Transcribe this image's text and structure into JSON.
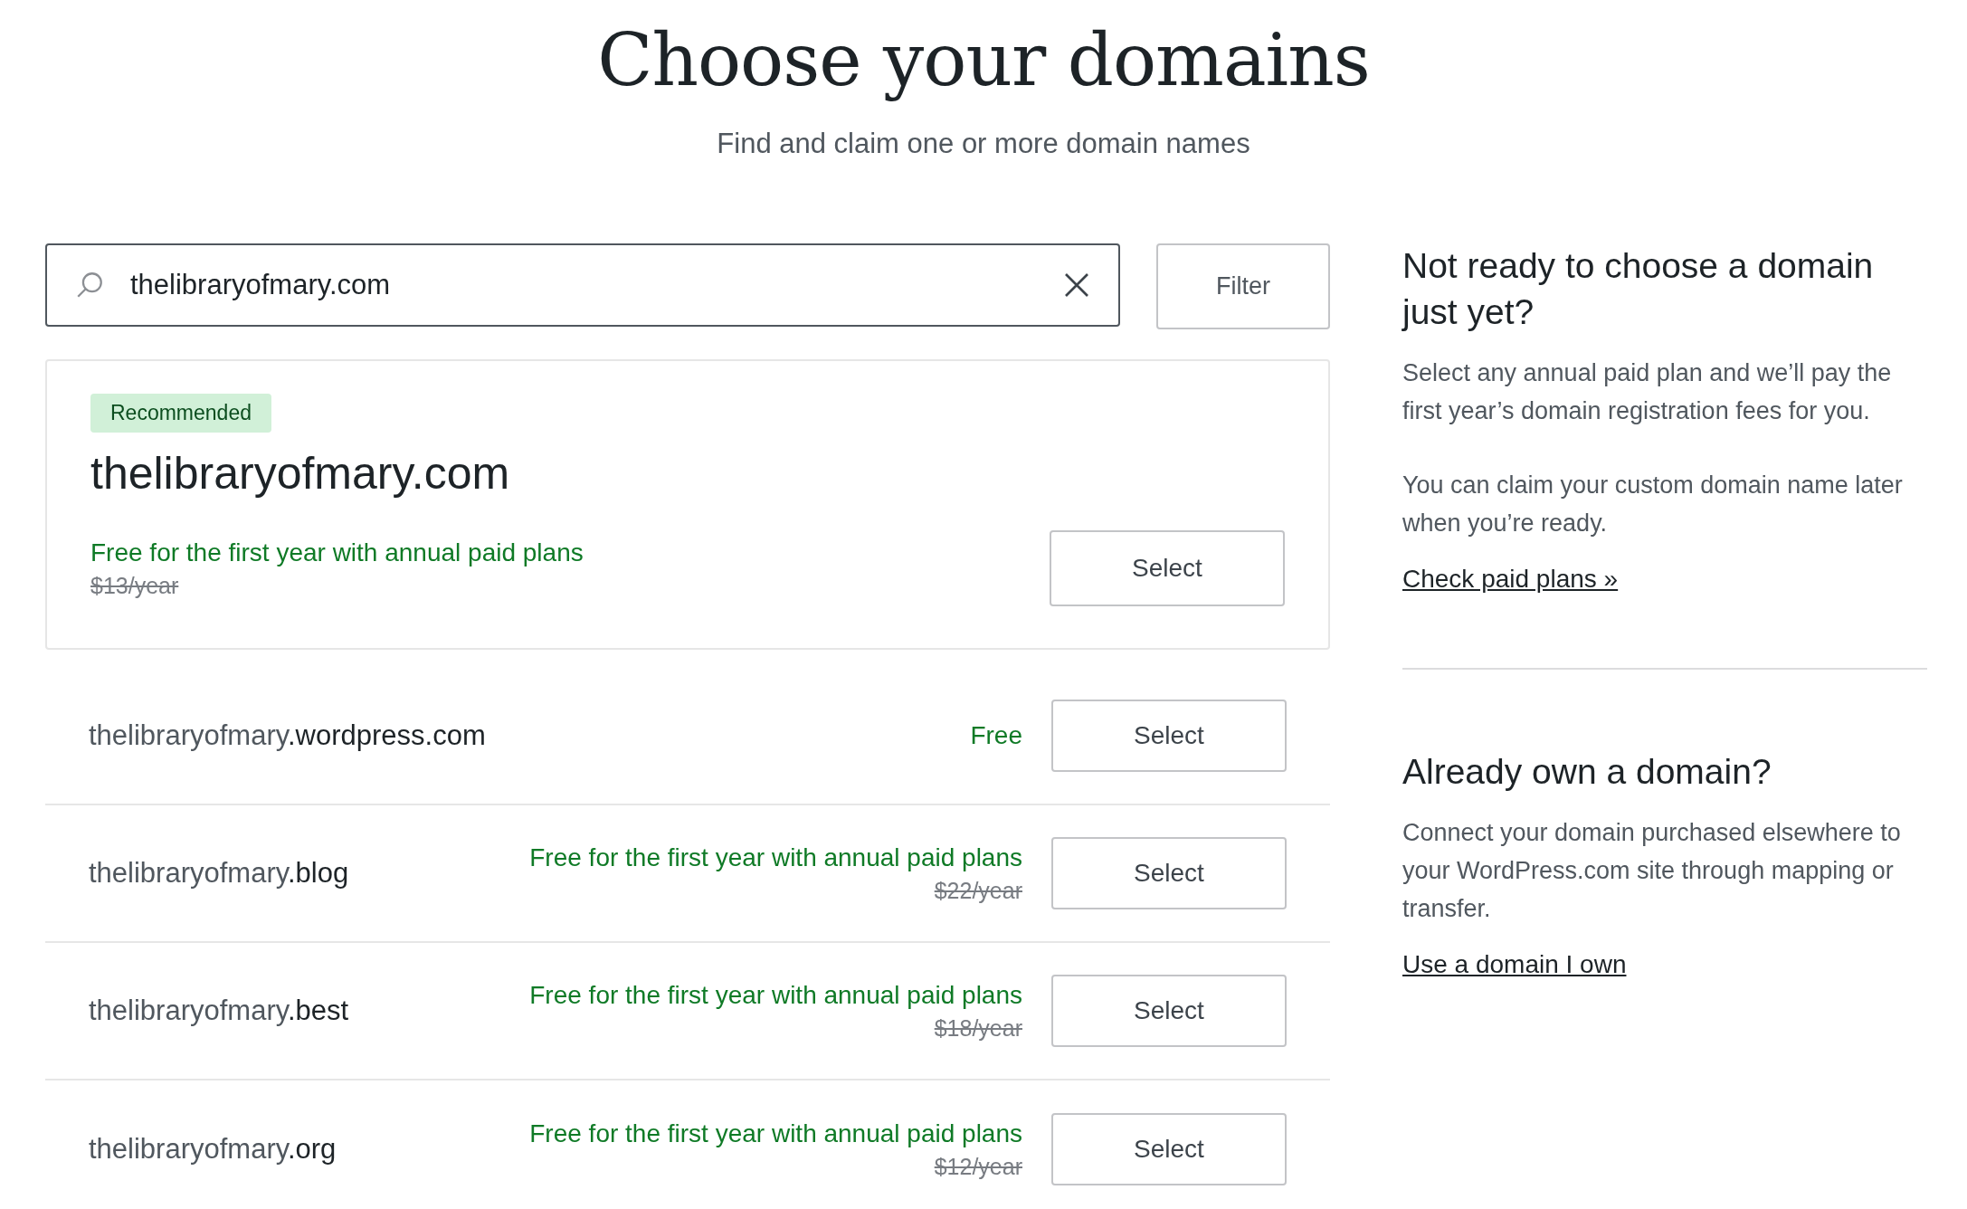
{
  "header": {
    "title": "Choose your domains",
    "subtitle": "Find and claim one or more domain names"
  },
  "search": {
    "value": "thelibraryofmary.com",
    "filter_label": "Filter"
  },
  "recommended": {
    "badge": "Recommended",
    "domain": "thelibraryofmary.com",
    "offer": "Free for the first year with annual paid plans",
    "old_price": "$13/year",
    "button": "Select"
  },
  "results": [
    {
      "domain": "thelibraryofmary**.wordpress.com**",
      "offer": "Free",
      "button": "Select"
    },
    {
      "domain": "thelibraryofmary**.blog**",
      "offer": "Free for the first year with annual paid plans",
      "old_price": "$22/year",
      "button": "Select"
    },
    {
      "domain": "thelibraryofmary**.best**",
      "offer": "Free for the first year with annual paid plans",
      "old_price": "$18/year",
      "button": "Select"
    },
    {
      "domain": "thelibraryofmary**.org**",
      "offer": "Free for the first year with annual paid plans",
      "old_price": "$12/year",
      "button": "Select"
    }
  ],
  "sidebar": [
    {
      "heading": "Not ready to choose a domain just yet?",
      "paragraphs": [
        "Select any annual paid plan and we’ll pay the first year’s domain registration fees for you.",
        "You can claim your custom domain name later when you’re ready."
      ],
      "link": "Check paid plans »"
    },
    {
      "heading": "Already own a domain?",
      "paragraphs": [
        "Connect your domain purchased elsewhere to your WordPress.com site through mapping or transfer."
      ],
      "link": "Use a domain I own"
    }
  ]
}
